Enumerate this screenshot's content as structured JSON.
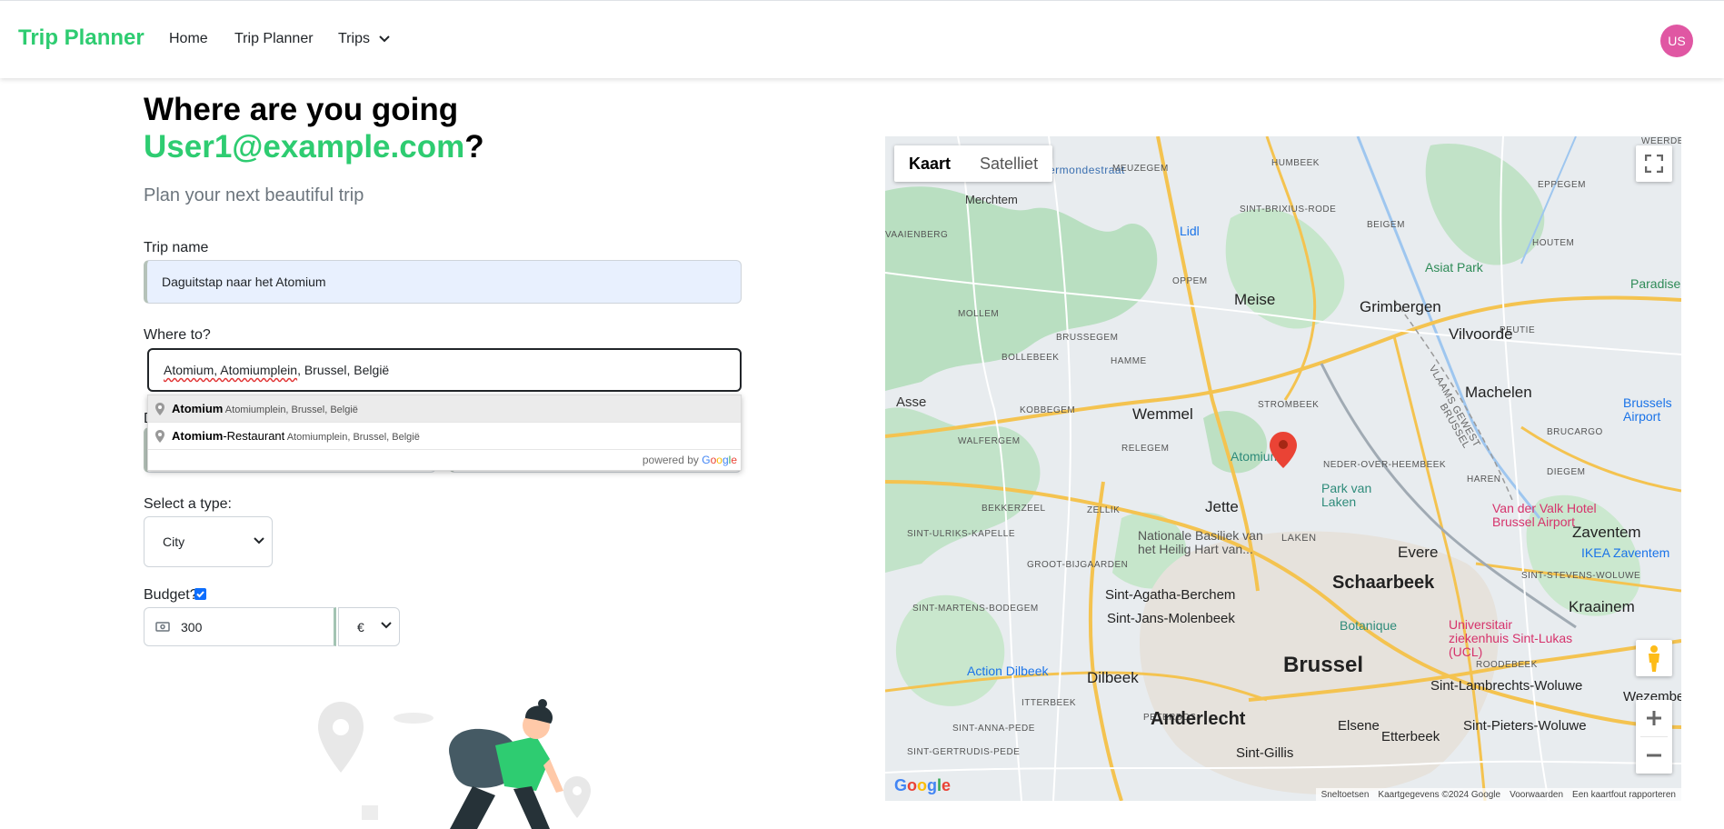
{
  "navbar": {
    "brand": "Trip Planner",
    "home": "Home",
    "planner": "Trip Planner",
    "trips": "Trips",
    "avatar": "US"
  },
  "header": {
    "title": "Where are you going",
    "email": "User1@example.com",
    "question_mark": "?",
    "subtitle": "Plan your next beautiful trip"
  },
  "form": {
    "trip_name_label": "Trip name",
    "trip_name_value": "Daguitstap naar het Atomium",
    "where_label": "Where to?",
    "where_value_squiggle": "Atomium, Atomiumplein",
    "where_value_rest": ", Brussel, België",
    "hidden_label": "D",
    "type_label": "Select a type:",
    "type_value": "City",
    "budget_label": "Budget?",
    "budget_value": "300",
    "currency_value": "€"
  },
  "autocomplete": {
    "items": [
      {
        "main": "Atomium",
        "main_suffix": "",
        "secondary": "Atomiumplein, Brussel, België"
      },
      {
        "main": "Atomium",
        "main_suffix": "-Restaurant",
        "secondary": "Atomiumplein, Brussel, België"
      }
    ],
    "powered_by": "powered by",
    "google": [
      "G",
      "o",
      "o",
      "g",
      "l",
      "e"
    ]
  },
  "map": {
    "type_buttons": [
      "Kaart",
      "Satelliet"
    ],
    "logo": "Google",
    "footer": [
      "Sneltoetsen",
      "Kaartgegevens ©2024 Google",
      "Voorwaarden",
      "Een kaartfout rapporteren"
    ],
    "places": {
      "brussel": "Brussel",
      "schaarbeek": "Schaarbeek",
      "anderlecht": "Anderlecht",
      "meise": "Meise",
      "grimbergen": "Grimbergen",
      "vilvoorde": "Vilvoorde",
      "machelen": "Machelen",
      "wemmel": "Wemmel",
      "jette": "Jette",
      "evere": "Evere",
      "zaventem": "Zaventem",
      "kraainem": "Kraainem",
      "merchtem": "Merchtem",
      "asse": "Asse",
      "dilbeek": "Dilbeek",
      "elsene": "Elsene",
      "etterbeek": "Etterbeek",
      "sintgillis": "Sint-Gillis",
      "sintjans": "Sint-Jans-Molenbeek",
      "sintagatha": "Sint-Agatha-Berchem",
      "sintlambrechts": "Sint-Lambrechts-Woluwe",
      "sintpieters": "Sint-Pieters-Woluwe",
      "wezembeek": "Wezembeek",
      "laken": "LAKEN",
      "atomium": "Atomium",
      "parkvanlaken": "Park van Laken",
      "lidl": "Lidl",
      "asiatpark": "Asiat Park",
      "paradise": "Paradise Cit",
      "brusselsairport": "Brussels Airport",
      "vandervalk": "Van der Valk Hotel Brussel Airport",
      "ikea": "IKEA Zaventem",
      "basiliek": "Nationale Basiliek van het Heilig Hart van...",
      "botanique": "Botanique",
      "actiondilbeek": "Action Dilbeek",
      "ziekenhuis": "Universitair ziekenhuis Sint-Lukas (UCL)",
      "vlaamsgewest": "VLAAMS GEWEST",
      "brusselregion": "BRUSSEL",
      "wolvertem": "ermondestraat",
      "humbeek": "HUMBEEK",
      "meuzegem": "MEUZEGEM",
      "sintbrixius": "SINT-BRIXIUS-RODE",
      "beigem": "BEIGEM",
      "eppegem": "EPPEGEM",
      "houtem": "HOUTEM",
      "peutie": "PEUTIE",
      "oppem": "OPPEM",
      "mollem": "MOLLEM",
      "brussegem": "BRUSSEGEM",
      "hamme": "HAMME",
      "bollebeek": "BOLLEBEEK",
      "kobbegem": "KOBBEGEM",
      "walfergem": "WALFERGEM",
      "relegem": "RELEGEM",
      "strombeek": "STROMBEEK",
      "neder": "NEDER-OVER-HEEMBEEK",
      "haren": "HAREN",
      "diegem": "DIEGEM",
      "bekkerzeel": "BEKKERZEEL",
      "zellik": "ZELLIK",
      "sintulriks": "SINT-ULRIKS-KAPELLE",
      "grootbijgaarden": "GROOT-BIJGAARDEN",
      "sintmartens": "SINT-MARTENS-BODEGEM",
      "itterbeek": "ITTERBEEK",
      "sintanna": "SINT-ANNA-PEDE",
      "sintgertrudis": "SINT-GERTRUDIS-PEDE",
      "peterbos": "PETERBOS",
      "roodebeek": "ROODEBEEK",
      "sintstevens": "SINT-STEVENS-WOLUWE",
      "waaienberg": "VAAIENBERG",
      "weerde": "WEERDE",
      "bucarcgo": "BRUCARGO"
    }
  },
  "colors": {
    "brand": "#2ecc71",
    "avatar": "#e057a3",
    "marker": "#ea4335",
    "checkbox": "#0d6efd"
  }
}
